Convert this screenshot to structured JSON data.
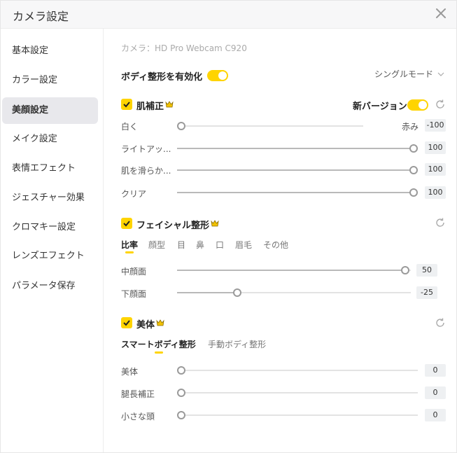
{
  "window": {
    "title": "カメラ設定"
  },
  "sidebar": {
    "items": [
      {
        "label": "基本設定"
      },
      {
        "label": "カラー設定"
      },
      {
        "label": "美顔設定",
        "active": true
      },
      {
        "label": "メイク設定"
      },
      {
        "label": "表情エフェクト"
      },
      {
        "label": "ジェスチャー効果"
      },
      {
        "label": "クロマキー設定"
      },
      {
        "label": "レンズエフェクト"
      },
      {
        "label": "パラメータ保存"
      }
    ]
  },
  "main": {
    "camera_label": "カメラ：HD Pro Webcam C920",
    "body_shaping_toggle_label": "ボディ整形を有効化",
    "mode_select": "シングルモード",
    "skin": {
      "title": "肌補正",
      "new_version_label": "新バージョン",
      "sliders": [
        {
          "label": "白く",
          "right_label": "赤み",
          "value": "-100"
        },
        {
          "label": "ライトアッ...",
          "value": "100"
        },
        {
          "label": "肌を滑らか...",
          "value": "100"
        },
        {
          "label": "クリア",
          "value": "100"
        }
      ]
    },
    "facial": {
      "title": "フェイシャル整形",
      "tabs": [
        "比率",
        "顔型",
        "目",
        "鼻",
        "口",
        "眉毛",
        "その他"
      ],
      "active_tab": "比率",
      "sliders": [
        {
          "label": "中顔面",
          "value": "50"
        },
        {
          "label": "下顔面",
          "value": "-25"
        }
      ]
    },
    "body": {
      "title": "美体",
      "tabs": [
        "スマートボディ整形",
        "手動ボディ整形"
      ],
      "active_tab": "スマートボディ整形",
      "sliders": [
        {
          "label": "美体",
          "value": "0"
        },
        {
          "label": "腿長補正",
          "value": "0"
        },
        {
          "label": "小さな頭",
          "value": "0"
        }
      ]
    }
  },
  "colors": {
    "accent": "#ffd400",
    "sidebar_active_bg": "#e8e8ec",
    "value_box_bg": "#eef0f2"
  },
  "icons": [
    "close-icon",
    "chevron-down-icon",
    "check-icon",
    "crown-icon",
    "refresh-icon"
  ]
}
